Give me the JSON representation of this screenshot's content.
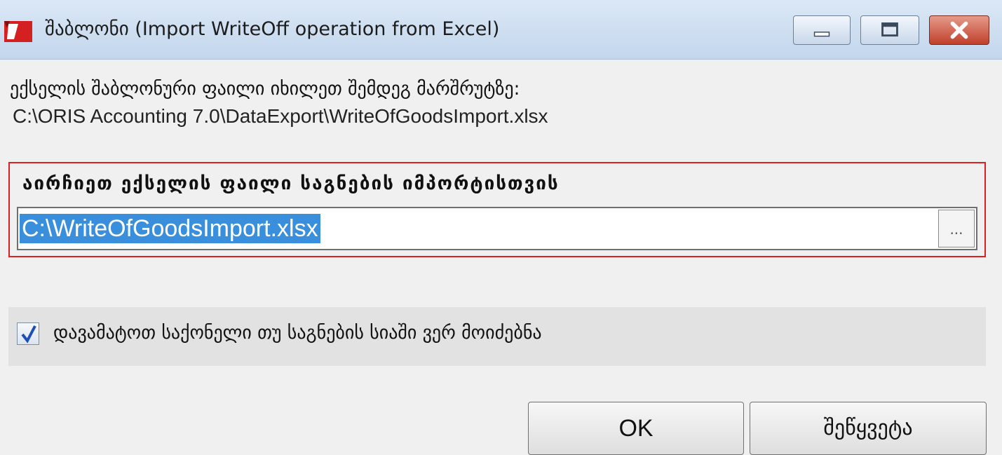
{
  "window": {
    "title": "შაბლონი (Import WriteOff operation from Excel)",
    "buttons": {
      "minimize": "minimize-icon",
      "maximize": "maximize-icon",
      "close": "close-icon"
    }
  },
  "info": {
    "line1": "ექსელის შაბლონური ფაილი იხილეთ შემდეგ მარშრუტზე:",
    "line2": "C:\\ORIS Accounting 7.0\\DataExport\\WriteOfGoodsImport.xlsx"
  },
  "file_select": {
    "label": "აირჩიეთ ექსელის ფაილი საგნების იმპორტისთვის",
    "value": "C:\\WriteOfGoodsImport.xlsx",
    "browse_label": "..."
  },
  "option": {
    "checked": true,
    "label": "დავამატოთ საქონელი თუ საგნების სიაში ვერ მოიძებნა"
  },
  "actions": {
    "ok_label": "OK",
    "cancel_label": "შეწყვეტა"
  },
  "colors": {
    "highlight_border": "#e02020",
    "selection": "#3a8fdc"
  }
}
